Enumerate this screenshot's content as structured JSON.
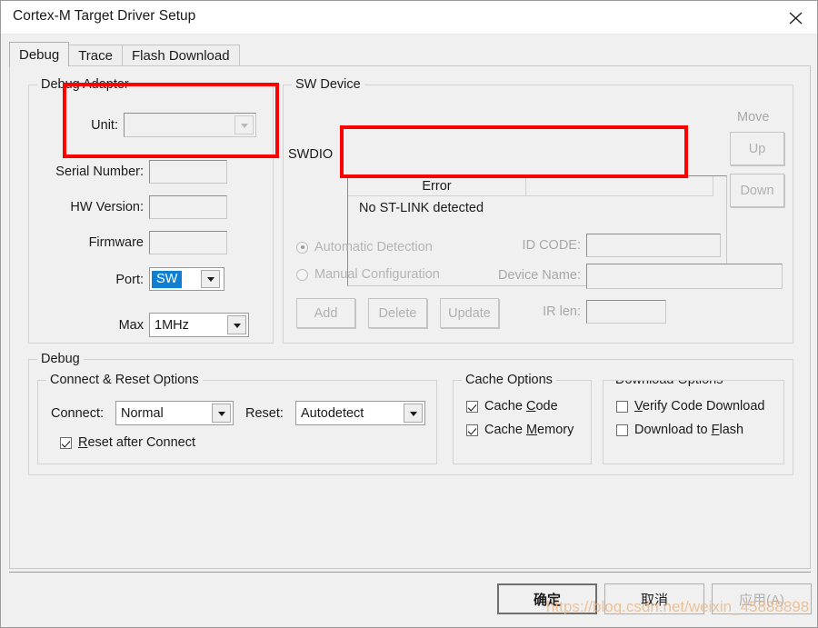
{
  "window": {
    "title": "Cortex-M Target Driver Setup",
    "close_icon": "close-icon"
  },
  "tabs": [
    {
      "label": "Debug",
      "active": true
    },
    {
      "label": "Trace",
      "active": false
    },
    {
      "label": "Flash Download",
      "active": false
    }
  ],
  "debug_adapter": {
    "legend": "Debug Adapter",
    "unit_label": "Unit:",
    "unit_value": "",
    "serial_label": "Serial Number:",
    "serial_value": "",
    "hw_label": "HW Version:",
    "hw_value": "",
    "firmware_label": "Firmware",
    "firmware_value": "",
    "port_label": "Port:",
    "port_value": "SW",
    "max_label": "Max",
    "max_value": "1MHz"
  },
  "sw_device": {
    "legend": "SW Device",
    "swdio_label": "SWDIO",
    "columns": [
      "Error",
      ""
    ],
    "rows": [
      [
        "No ST-LINK detected",
        ""
      ]
    ],
    "move_label": "Move",
    "up_label": "Up",
    "down_label": "Down",
    "automatic_detection": "Automatic Detection",
    "manual_configuration": "Manual Configuration",
    "selected_mode": "Automatic Detection",
    "id_code_label": "ID CODE:",
    "id_code_value": "",
    "device_name_label": "Device Name:",
    "device_name_value": "",
    "ir_len_label": "IR len:",
    "ir_len_value": "",
    "add_label": "Add",
    "delete_label": "Delete",
    "update_label": "Update"
  },
  "debug_group": {
    "legend": "Debug",
    "connect_reset": {
      "legend": "Connect & Reset Options",
      "connect_label": "Connect:",
      "connect_value": "Normal",
      "reset_label": "Reset:",
      "reset_value": "Autodetect",
      "reset_after_connect": {
        "prefix": "R",
        "rest": "eset after Connect",
        "checked": true
      }
    },
    "cache_options": {
      "legend": "Cache Options",
      "cache_code": {
        "pre": "Cache ",
        "key": "C",
        "post": "ode",
        "checked": true
      },
      "cache_memory": {
        "pre": "Cache ",
        "key": "M",
        "post": "emory",
        "checked": true
      }
    },
    "download_options": {
      "legend": "Download Options",
      "verify_code": {
        "pre": "",
        "key": "V",
        "post": "erify Code Download",
        "checked": false
      },
      "download_flash": {
        "pre": "Download to ",
        "key": "F",
        "post": "lash",
        "checked": false
      }
    }
  },
  "dialog_buttons": {
    "ok": "确定",
    "cancel": "取消",
    "apply": "应用(A)"
  },
  "watermark": "https://blog.csdn.net/weixin_45888898",
  "colors": {
    "accent_selection": "#0F7FD4",
    "annotation": "#FF0000",
    "background": "#F0F0F0",
    "text": "#1A1A1A",
    "disabled_text": "#B0B0B0"
  }
}
